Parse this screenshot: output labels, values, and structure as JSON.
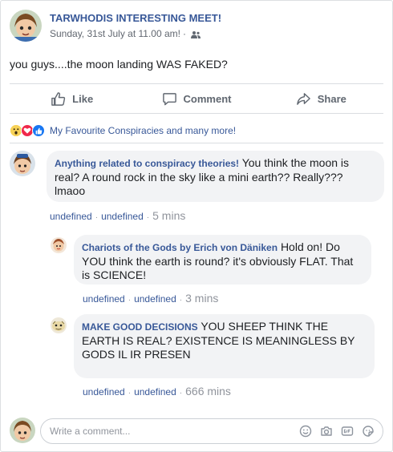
{
  "post": {
    "author": "TARWHODIS INTERESTING MEET!",
    "timestamp": "Sunday, 31st July at 11.00 am!",
    "separator": "·",
    "text": "you guys....the moon landing WAS FAKED?"
  },
  "actions": {
    "like": "Like",
    "comment": "Comment",
    "share": "Share"
  },
  "reactions": {
    "summary": "My Favourite Conspiracies and many more!"
  },
  "comments": [
    {
      "author": "Anything related to conspiracy theories!",
      "text": "You think the moon is real? A round rock in the sky like a mini earth?? Really??? lmaoo",
      "link1": "undefined",
      "link2": "undefined",
      "time": "5 mins"
    },
    {
      "author": "Chariots of the Gods by Erich von Däniken",
      "text": "Hold on! Do YOU think the earth is round? it's obviously FLAT. That is SCIENCE!",
      "link1": "undefined",
      "link2": "undefined",
      "time": "3 mins"
    },
    {
      "author": "MAKE GOOD DECISIONS",
      "text": "YOU SHEEP THINK THE EARTH IS REAL? EXISTENCE IS MEANINGLESS BY GODS IL  IR PRESEN",
      "link1": "undefined",
      "link2": "undefined",
      "time": "666 mins"
    }
  ],
  "composer": {
    "placeholder": "Write a comment..."
  },
  "colors": {
    "link": "#385898",
    "bubble": "#f2f3f5",
    "muted": "#90949c"
  }
}
